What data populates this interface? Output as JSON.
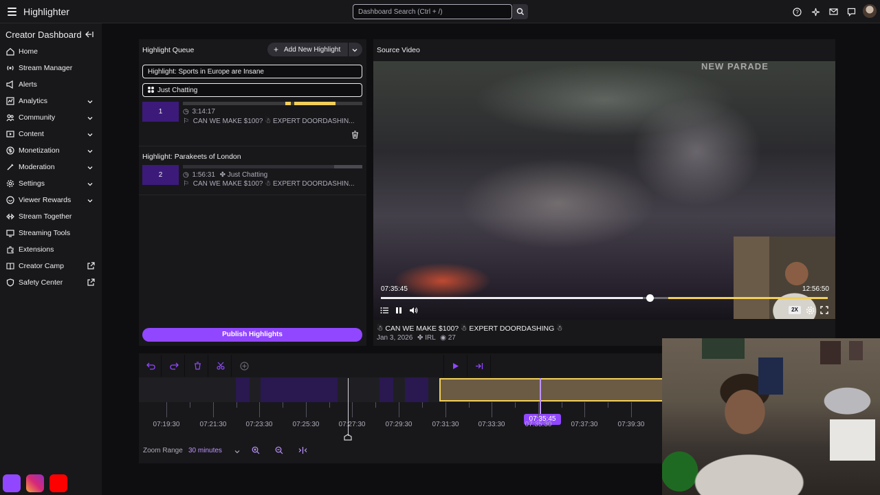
{
  "topbar": {
    "title": "Highlighter",
    "search_placeholder": "Dashboard Search (Ctrl + /)"
  },
  "sidebar": {
    "title": "Creator Dashboard",
    "items": [
      {
        "label": "Home",
        "icon": "home-icon",
        "chevron": false
      },
      {
        "label": "Stream Manager",
        "icon": "stream-manager-icon",
        "chevron": false
      },
      {
        "label": "Alerts",
        "icon": "alerts-icon",
        "chevron": false
      },
      {
        "label": "Analytics",
        "icon": "analytics-icon",
        "chevron": true
      },
      {
        "label": "Community",
        "icon": "community-icon",
        "chevron": true
      },
      {
        "label": "Content",
        "icon": "content-icon",
        "chevron": true
      },
      {
        "label": "Monetization",
        "icon": "monetization-icon",
        "chevron": true
      },
      {
        "label": "Moderation",
        "icon": "moderation-icon",
        "chevron": true
      },
      {
        "label": "Settings",
        "icon": "settings-icon",
        "chevron": true
      },
      {
        "label": "Viewer Rewards",
        "icon": "viewer-rewards-icon",
        "chevron": true
      },
      {
        "label": "Stream Together",
        "icon": "stream-together-icon",
        "chevron": false
      },
      {
        "label": "Streaming Tools",
        "icon": "streaming-tools-icon",
        "chevron": false
      },
      {
        "label": "Extensions",
        "icon": "extensions-icon",
        "chevron": false
      },
      {
        "label": "Creator Camp",
        "icon": "creator-camp-icon",
        "external": true
      },
      {
        "label": "Safety Center",
        "icon": "safety-center-icon",
        "external": true
      }
    ]
  },
  "queue": {
    "title": "Highlight Queue",
    "add_label": "Add New Highlight",
    "title_field": "Highlight: Sports in Europe are Insane",
    "category_field": "Just Chatting",
    "items": [
      {
        "number": "1",
        "duration": "3:14:17",
        "stream_title": "CAN WE MAKE $100? ☃ EXPERT DOORDASHIN..."
      },
      {
        "number": "2",
        "heading": "Highlight: Parakeets of London",
        "duration": "1:56:31",
        "category": "Just Chatting",
        "stream_title": "CAN WE MAKE $100? ☃ EXPERT DOORDASHIN..."
      }
    ],
    "publish_label": "Publish Highlights"
  },
  "video": {
    "title": "Source Video",
    "watermark": "NEW PARADE",
    "current_time": "07:35:45",
    "end_time": "12:56:50",
    "speed": "2X",
    "progress": 0.59,
    "stream_title": "☃ CAN WE MAKE $100? ☃ EXPERT DOORDASHING ☃",
    "date": "Jan 3, 2026",
    "category": "IRL",
    "views": "27"
  },
  "timeline": {
    "ticks": [
      "07:19:30",
      "07:21:30",
      "07:23:30",
      "07:25:30",
      "07:27:30",
      "07:29:30",
      "07:31:30",
      "07:33:30",
      "07:35:30",
      "07:37:30",
      "07:39:30"
    ],
    "cursor_time": "07:35:45",
    "zoom_label": "Zoom Range",
    "zoom_value": "30 minutes"
  },
  "colors": {
    "accent": "#9147ff",
    "highlight": "#f2cf59",
    "background": "#0e0e10",
    "panel": "#18181b"
  }
}
